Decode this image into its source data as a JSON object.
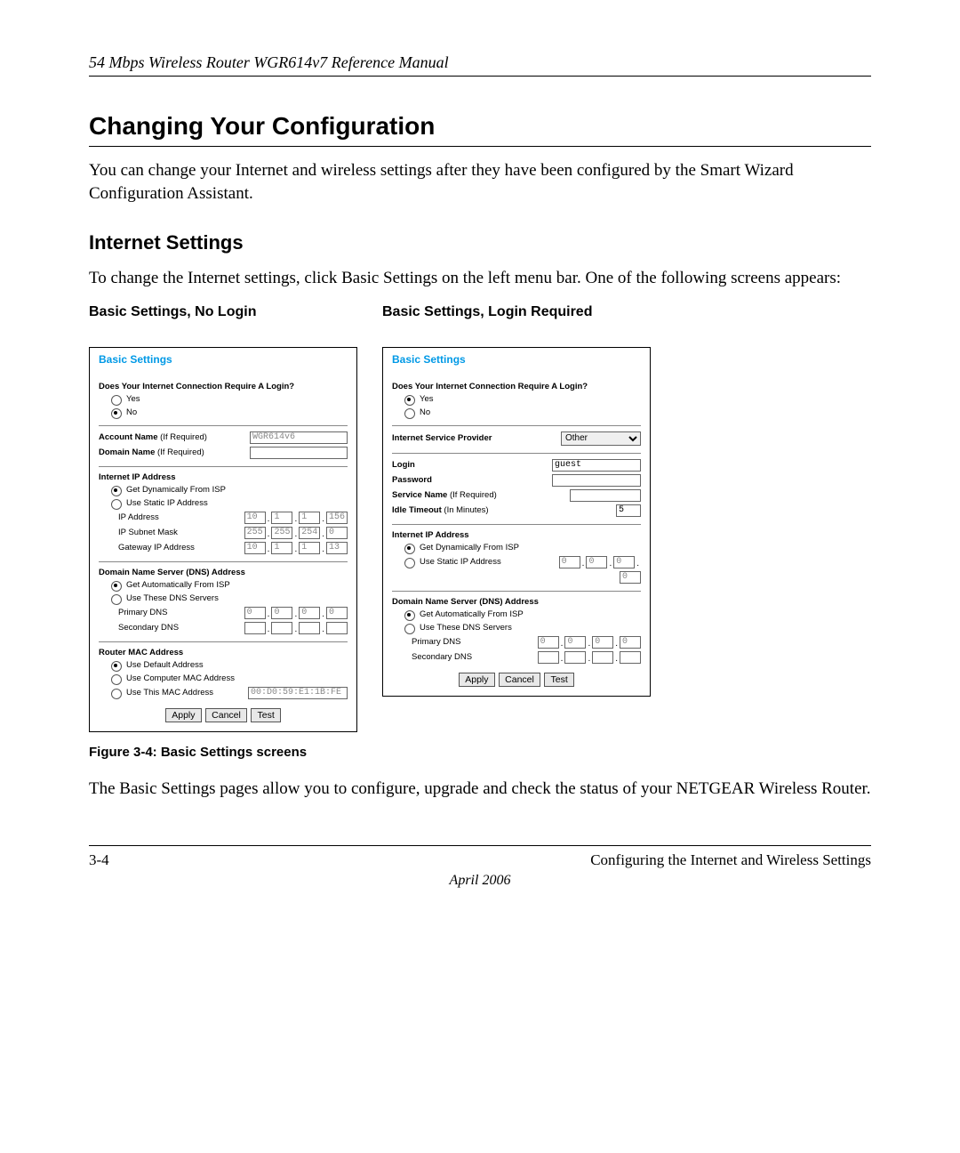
{
  "header": "54 Mbps Wireless Router WGR614v7 Reference Manual",
  "section_title": "Changing Your Configuration",
  "intro_para": "You can change your Internet and wireless settings after they have been configured by the Smart Wizard Configuration Assistant.",
  "subsection_title": "Internet Settings",
  "sub_para": "To change the Internet settings, click Basic Settings on the left menu bar. One of the following screens appears:",
  "left_col_title": "Basic Settings, No Login",
  "right_col_title": "Basic Settings, Login Required",
  "figure_caption": "Figure 3-4:  Basic Settings screens",
  "closing_para": "The Basic Settings pages allow you to configure, upgrade and check the status of your NETGEAR Wireless Router.",
  "footer_left": "3-4",
  "footer_right": "Configuring the Internet and Wireless Settings",
  "footer_date": "April 2006",
  "panel": {
    "title": "Basic Settings",
    "q_login": "Does Your Internet Connection Require A Login?",
    "yes": "Yes",
    "no": "No",
    "account_name": "Account Name",
    "domain_name": "Domain Name",
    "if_required": "(If Required)",
    "acct_val": "WGR614v6",
    "ip_header": "Internet IP Address",
    "get_dyn": "Get Dynamically From ISP",
    "use_static": "Use Static IP Address",
    "ip_addr": "IP Address",
    "subnet": "IP Subnet Mask",
    "gateway": "Gateway IP Address",
    "dns_header": "Domain Name Server (DNS) Address",
    "get_auto": "Get Automatically From ISP",
    "use_dns": "Use These DNS Servers",
    "pdns": "Primary DNS",
    "sdns": "Secondary DNS",
    "mac_header": "Router MAC Address",
    "use_default": "Use Default Address",
    "use_comp": "Use Computer MAC Address",
    "use_this": "Use This MAC Address",
    "mac_val": "00:D0:59:E1:1B:FE",
    "isp_label": "Internet Service Provider",
    "isp_opt": "Other",
    "login": "Login",
    "login_val": "guest",
    "password": "Password",
    "service_name": "Service Name",
    "idle": "Idle Timeout",
    "idle_hint": "(In Minutes)",
    "idle_val": "5",
    "apply": "Apply",
    "cancel": "Cancel",
    "test": "Test",
    "ip_a": [
      "10",
      "1",
      "1",
      "156"
    ],
    "mask": [
      "255",
      "255",
      "254",
      "0"
    ],
    "gw": [
      "10",
      "1",
      "1",
      "13"
    ],
    "zero4": [
      "0",
      "0",
      "0",
      "0"
    ],
    "zero3": [
      "0",
      "0",
      "0"
    ]
  }
}
